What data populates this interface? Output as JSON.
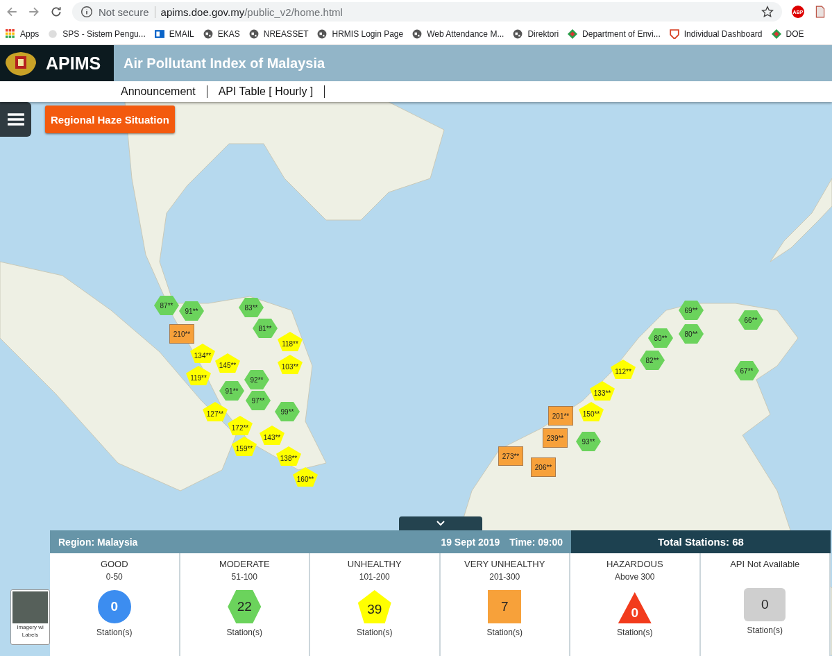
{
  "browser": {
    "security": "Not secure",
    "url_host": "apims.doe.gov.my",
    "url_path": "/public_v2/home.html",
    "bookmarks": [
      {
        "label": "Apps",
        "kind": "apps"
      },
      {
        "label": "SPS - Sistem Pengu...",
        "kind": "page"
      },
      {
        "label": "EMAIL",
        "kind": "mail"
      },
      {
        "label": "EKAS",
        "kind": "globe"
      },
      {
        "label": "NREASSET",
        "kind": "globe"
      },
      {
        "label": "HRMIS Login Page",
        "kind": "globe"
      },
      {
        "label": "Web Attendance M...",
        "kind": "globe"
      },
      {
        "label": "Direktori",
        "kind": "globe"
      },
      {
        "label": "Department of Envi...",
        "kind": "diamond"
      },
      {
        "label": "Individual Dashboard",
        "kind": "shield"
      },
      {
        "label": "DOE",
        "kind": "diamond"
      }
    ],
    "extension_badge": "ABP"
  },
  "header": {
    "brand": "APIMS",
    "title": "Air Pollutant Index of Malaysia"
  },
  "nav": [
    "Announcement",
    "API Table [ Hourly ]"
  ],
  "haze_button": "Regional Haze Situation",
  "basemap": {
    "label_line_1": "Imagery wi",
    "label_line_2": "Labels"
  },
  "markers": [
    {
      "kind": "moderate",
      "label": "87**"
    },
    {
      "kind": "moderate",
      "label": "91**"
    },
    {
      "kind": "moderate",
      "label": "83**"
    },
    {
      "kind": "moderate",
      "label": "81**"
    },
    {
      "kind": "unhealthy",
      "label": "118**"
    },
    {
      "kind": "unhealthy",
      "label": "134**"
    },
    {
      "kind": "very_unhealthy",
      "label": "210**"
    },
    {
      "kind": "unhealthy",
      "label": "145**"
    },
    {
      "kind": "unhealthy",
      "label": "119**"
    },
    {
      "kind": "unhealthy",
      "label": "103**"
    },
    {
      "kind": "moderate",
      "label": "92**"
    },
    {
      "kind": "moderate",
      "label": "97**"
    },
    {
      "kind": "moderate",
      "label": "91**"
    },
    {
      "kind": "unhealthy",
      "label": "127**"
    },
    {
      "kind": "unhealthy",
      "label": "172**"
    },
    {
      "kind": "unhealthy",
      "label": "159**"
    },
    {
      "kind": "unhealthy",
      "label": "143**"
    },
    {
      "kind": "moderate",
      "label": "99**"
    },
    {
      "kind": "unhealthy",
      "label": "138**"
    },
    {
      "kind": "unhealthy",
      "label": "160**"
    },
    {
      "kind": "moderate",
      "label": "69**"
    },
    {
      "kind": "moderate",
      "label": "66**"
    },
    {
      "kind": "moderate",
      "label": "80**"
    },
    {
      "kind": "moderate",
      "label": "80**"
    },
    {
      "kind": "moderate",
      "label": "82**"
    },
    {
      "kind": "unhealthy",
      "label": "112**"
    },
    {
      "kind": "moderate",
      "label": "67**"
    },
    {
      "kind": "unhealthy",
      "label": "133**"
    },
    {
      "kind": "very_unhealthy",
      "label": "201**"
    },
    {
      "kind": "unhealthy",
      "label": "150**"
    },
    {
      "kind": "very_unhealthy",
      "label": "239**"
    },
    {
      "kind": "moderate",
      "label": "93**"
    },
    {
      "kind": "very_unhealthy",
      "label": "273**"
    },
    {
      "kind": "very_unhealthy",
      "label": "206**"
    }
  ],
  "summary": {
    "region": "Region: Malaysia",
    "date": "19 Sept 2019",
    "time": "Time: 09:00",
    "total": "Total Stations: 68",
    "categories": [
      {
        "kind": "good",
        "name": "GOOD",
        "range": "0-50",
        "count": "0",
        "unit": "Station(s)"
      },
      {
        "kind": "moderate",
        "name": "MODERATE",
        "range": "51-100",
        "count": "22",
        "unit": "Station(s)"
      },
      {
        "kind": "unhealthy",
        "name": "UNHEALTHY",
        "range": "101-200",
        "count": "39",
        "unit": "Station(s)"
      },
      {
        "kind": "very_unhealthy",
        "name": "VERY UNHEALTHY",
        "range": "201-300",
        "count": "7",
        "unit": "Station(s)"
      },
      {
        "kind": "hazardous",
        "name": "HAZARDOUS",
        "range": "Above 300",
        "count": "0",
        "unit": "Station(s)"
      },
      {
        "kind": "na",
        "name": "API Not Available",
        "count": "0",
        "unit": "Station(s)"
      }
    ]
  }
}
